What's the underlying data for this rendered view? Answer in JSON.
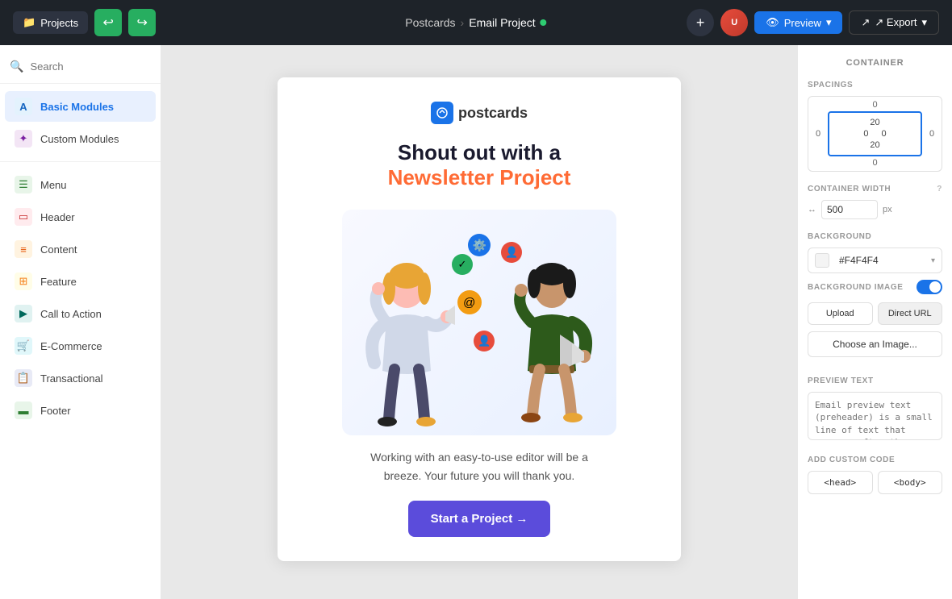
{
  "topbar": {
    "projects_label": "Projects",
    "breadcrumb_parent": "Postcards",
    "breadcrumb_child": "Email Project",
    "undo_label": "↩",
    "redo_label": "↪",
    "preview_label": "👁 Preview",
    "export_label": "↗ Export",
    "add_label": "+"
  },
  "sidebar": {
    "search_placeholder": "Search",
    "sections": [
      {
        "id": "basic-modules",
        "label": "Basic Modules",
        "icon": "A",
        "icon_class": "icon-blue",
        "active": true
      },
      {
        "id": "custom-modules",
        "label": "Custom Modules",
        "icon": "✦",
        "icon_class": "icon-purple",
        "active": false
      }
    ],
    "items": [
      {
        "id": "menu",
        "label": "Menu",
        "icon": "☰",
        "icon_class": "icon-green"
      },
      {
        "id": "header",
        "label": "Header",
        "icon": "▭",
        "icon_class": "icon-red"
      },
      {
        "id": "content",
        "label": "Content",
        "icon": "≡",
        "icon_class": "icon-orange"
      },
      {
        "id": "feature",
        "label": "Feature",
        "icon": "⊞",
        "icon_class": "icon-yellow"
      },
      {
        "id": "call-to-action",
        "label": "Call to Action",
        "icon": "▶",
        "icon_class": "icon-teal"
      },
      {
        "id": "e-commerce",
        "label": "E-Commerce",
        "icon": "🛒",
        "icon_class": "icon-cyan"
      },
      {
        "id": "transactional",
        "label": "Transactional",
        "icon": "📋",
        "icon_class": "icon-indigo"
      },
      {
        "id": "footer",
        "label": "Footer",
        "icon": "▬",
        "icon_class": "icon-green"
      }
    ]
  },
  "canvas": {
    "logo_text": "postcards",
    "headline_line1": "Shout out with a",
    "headline_line2": "Newsletter Project",
    "body_text": "Working with an easy-to-use editor will be a breeze. Your future you will thank you.",
    "cta_button": "Start a Project →"
  },
  "right_panel": {
    "title": "CONTAINER",
    "spacings_label": "SPACINGS",
    "spacing_top": "0",
    "spacing_right": "0",
    "spacing_bottom": "0",
    "spacing_left": "0",
    "spacing_inner_top": "20",
    "spacing_inner_right": "0",
    "spacing_inner_bottom": "20",
    "spacing_inner_left": "0",
    "container_width_label": "CONTAINER WIDTH",
    "container_width_value": "500",
    "container_width_unit": "px",
    "background_label": "BACKGROUND",
    "background_color": "#F4F4F4",
    "background_image_label": "BACKGROUND IMAGE",
    "upload_label": "Upload",
    "direct_url_label": "Direct URL",
    "choose_image_label": "Choose an Image...",
    "preview_text_label": "PREVIEW TEXT",
    "preview_text_placeholder": "Email preview text (preheader) is a small line of text that appears after the subject line in the inbox.",
    "add_custom_code_label": "ADD CUSTOM CODE",
    "head_btn": "<head>",
    "body_btn": "<body>"
  }
}
